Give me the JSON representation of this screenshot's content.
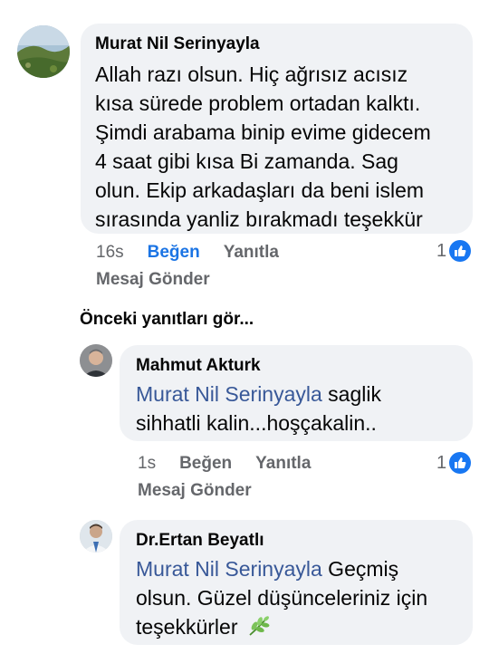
{
  "comment": {
    "author": "Murat Nil Serinyayla",
    "lines": [
      "Allah razı olsun. Hiç ağrısız acısız",
      "kısa sürede problem ortadan kalktı.",
      "Şimdi arabama binip evime gidecem",
      "4 saat gibi kısa Bi zamanda. Sag",
      "olun. Ekip arkadaşları da beni islem",
      "sırasında yanliz bırakmadı teşekkür"
    ],
    "time": "16s",
    "like_label": "Beğen",
    "reply_label": "Yanıtla",
    "reaction_count": "1",
    "message_label": "Mesaj Gönder"
  },
  "previous_replies_label": "Önceki yanıtları gör...",
  "replies": [
    {
      "author": "Mahmut Akturk",
      "mention": "Murat Nil Serinyayla",
      "line1_rest": " saglik",
      "line2": "sihhatli kalin...hoşçakalin..",
      "time": "1s",
      "like_label": "Beğen",
      "reply_label": "Yanıtla",
      "reaction_count": "1",
      "message_label": "Mesaj Gönder"
    },
    {
      "author": "Dr.Ertan Beyatlı",
      "mention": "Murat Nil Serinyayla",
      "line1_rest": " Geçmiş",
      "line2": "olsun. Güzel düşünceleriniz için",
      "line3": "teşekkürler",
      "emoji": "herb-emoji"
    }
  ],
  "colors": {
    "bubble": "#f0f2f5",
    "link": "#385898",
    "like_active": "#1b74e4",
    "like_badge": "#1877f2",
    "meta": "#65676b"
  }
}
